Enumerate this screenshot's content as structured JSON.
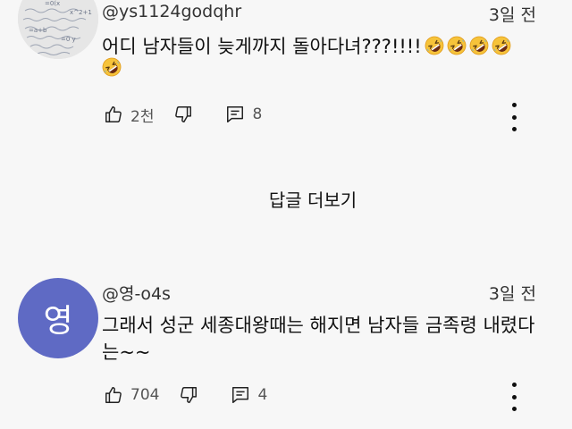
{
  "comments": [
    {
      "author": "@ys1124godqhr",
      "time": "3일 전",
      "text_line1": "어디 남자들이 늦게까지 돌아다녀???!!!!",
      "emoji_line1_count": 4,
      "emoji_line2_count": 1,
      "emoji_name": "rolling-on-floor-laughing-emoji",
      "likes": "2천",
      "replies": "8",
      "avatar": {
        "type": "handwritten-math-photo"
      }
    },
    {
      "author": "@영-o4s",
      "time": "3일 전",
      "text_line1": "그래서 성군 세종대왕때는 해지면 남자들 금족령 내렸다",
      "text_line2": "는~~",
      "likes": "704",
      "replies": "4",
      "avatar": {
        "type": "letter",
        "letter": "영",
        "color": "#5f6ac4"
      }
    }
  ],
  "replies_link": "답글 더보기",
  "colors": {
    "background": "#f7f7f7",
    "text": "#0f0f0f",
    "secondary_text": "#555555",
    "avatar_purple": "#5f6ac4"
  },
  "icons": [
    "thumbs-up-icon",
    "thumbs-down-icon",
    "comment-icon",
    "more-vertical-icon"
  ]
}
